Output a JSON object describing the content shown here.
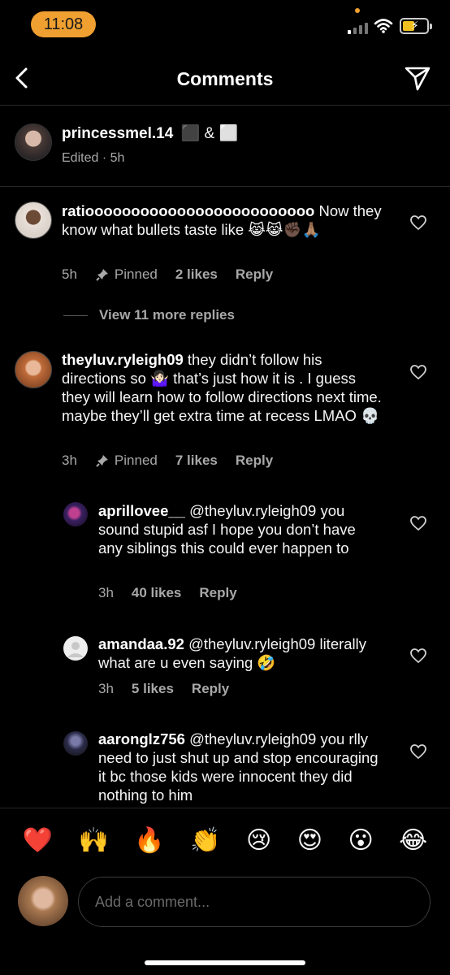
{
  "status_bar": {
    "time": "11:08"
  },
  "header": {
    "title": "Comments"
  },
  "caption": {
    "username": "princessmel.14",
    "text": "⬛ & ⬜",
    "meta": "Edited · 5h"
  },
  "comments": [
    {
      "username": "ratiooooooooooooooooooooooooo",
      "text": "Now they know what bullets taste like 😹😹✊🏿🙏🏽",
      "time": "5h",
      "pinned": "Pinned",
      "likes": "2 likes",
      "reply": "Reply"
    },
    {
      "username": "theyluv.ryleigh09",
      "text": "they didn’t follow his directions so 🤷🏻‍♀️ that’s just how it is . I guess they will learn how to follow directions next time. maybe they’ll get extra time at recess LMAO 💀",
      "time": "3h",
      "pinned": "Pinned",
      "likes": "7 likes",
      "reply": "Reply"
    }
  ],
  "view_more": "View 11 more replies",
  "replies": [
    {
      "username": "aprillovee__",
      "text": "@theyluv.ryleigh09 you sound stupid asf I hope you don’t have any siblings this could ever happen to",
      "time": "3h",
      "likes": "40 likes",
      "reply": "Reply"
    },
    {
      "username": "amandaa.92",
      "text": "@theyluv.ryleigh09 literally what are u even saying 🤣",
      "time": "3h",
      "likes": "5 likes",
      "reply": "Reply"
    },
    {
      "username": "aaronglz756",
      "text": "@theyluv.ryleigh09 you rlly need to just shut up and stop encouraging it bc those kids were innocent they did nothing to him"
    }
  ],
  "emoji_bar": [
    "❤️",
    "🙌",
    "🔥",
    "👏",
    "😢",
    "😍",
    "😮",
    "😂"
  ],
  "composer": {
    "placeholder": "Add a comment..."
  },
  "colors": {
    "accent": "#f0a030",
    "background": "#000000",
    "muted": "#a8a8a8"
  }
}
